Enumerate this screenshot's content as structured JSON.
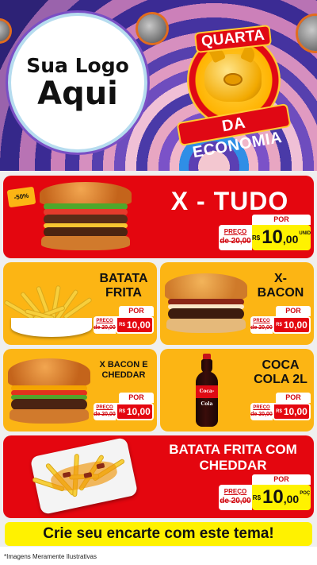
{
  "logo": {
    "line1": "Sua Logo",
    "line2": "Aqui"
  },
  "badge": {
    "top": "QUARTA",
    "bottom": "DA ECONOMIA"
  },
  "price_labels": {
    "por": "POR",
    "preco": "PREÇO",
    "currency": "R$"
  },
  "products": [
    {
      "name": "X - TUDO",
      "old": "de 20,00",
      "price_int": "10",
      "price_dec": ",00",
      "unit": "UNID",
      "discount": "-50%"
    },
    {
      "name_l1": "BATATA",
      "name_l2": "FRITA",
      "old": "de 20,00",
      "price": "10,00"
    },
    {
      "name_l1": "X-",
      "name_l2": "BACON",
      "old": "de 20,00",
      "price": "10,00"
    },
    {
      "name_l1": "X BACON E",
      "name_l2": "CHEDDAR",
      "old": "de 20,00",
      "price": "10,00"
    },
    {
      "name_l1": "COCA",
      "name_l2": "COLA 2L",
      "old": "de 20,00",
      "price": "10,00",
      "bottle_label": "Coca-Cola"
    },
    {
      "name_l1": "BATATA FRITA COM",
      "name_l2": "CHEDDAR",
      "old": "de 20,00",
      "price_int": "10",
      "price_dec": ",00",
      "unit": "POÇ"
    }
  ],
  "cta": "Crie seu encarte com este tema!",
  "footnote": "*Imagens Meramente Ilustrativas",
  "colors": {
    "red": "#e4060f",
    "yellow": "#fcb514",
    "highlight": "#fff200"
  }
}
